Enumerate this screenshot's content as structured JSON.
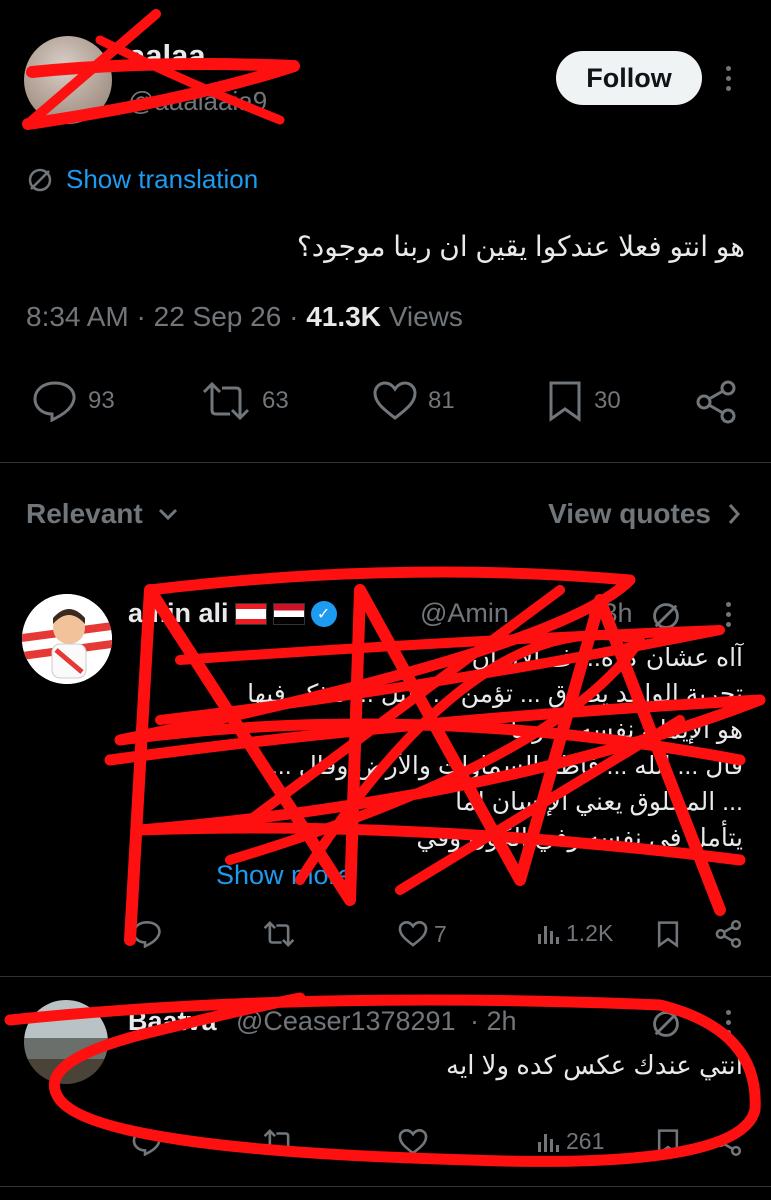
{
  "tweet": {
    "display_name": "aalaa",
    "handle": "@aaalaaia9",
    "follow_label": "Follow",
    "translate_label": "Show translation",
    "text": "هو انتو فعلا عندكوا يقين ان ربنا موجود؟",
    "time": "8:34 AM",
    "date": "22 Sep 26",
    "views_count": "41.3K",
    "views_label": "Views",
    "stats": {
      "replies": "93",
      "reposts": "63",
      "likes": "81",
      "bookmarks": "30"
    }
  },
  "filter": {
    "relevant_label": "Relevant",
    "view_quotes_label": "View quotes"
  },
  "reply1": {
    "name": "amin ali",
    "handle": "@Amin",
    "time": "· 3h",
    "lines": [
      "آاه عشان كده... ف الإيمان",
      "تجربة الواحد يصدق ... تؤمن ... دليل ... تتذكر فيها",
      "هو الإيمان نفسه ... ربنا",
      "قال ... الله ... فاطر السماوات والأرض وقال ...",
      "... المخلوق يعني الإنسان لما",
      "يتأمل في نفسه وفي الكون وفي"
    ],
    "show_more": "Show more",
    "likes": "7",
    "views": "1.2K"
  },
  "reply2": {
    "name": "Baatva",
    "handle": "@Ceaser1378291",
    "time": "· 2h",
    "text": "انتي عندك عكس كده ولا ايه",
    "views": "261"
  },
  "colors": {
    "accent": "#1d9bf0",
    "muted": "#71767b",
    "background": "#000000",
    "scribble": "#ff1010"
  }
}
